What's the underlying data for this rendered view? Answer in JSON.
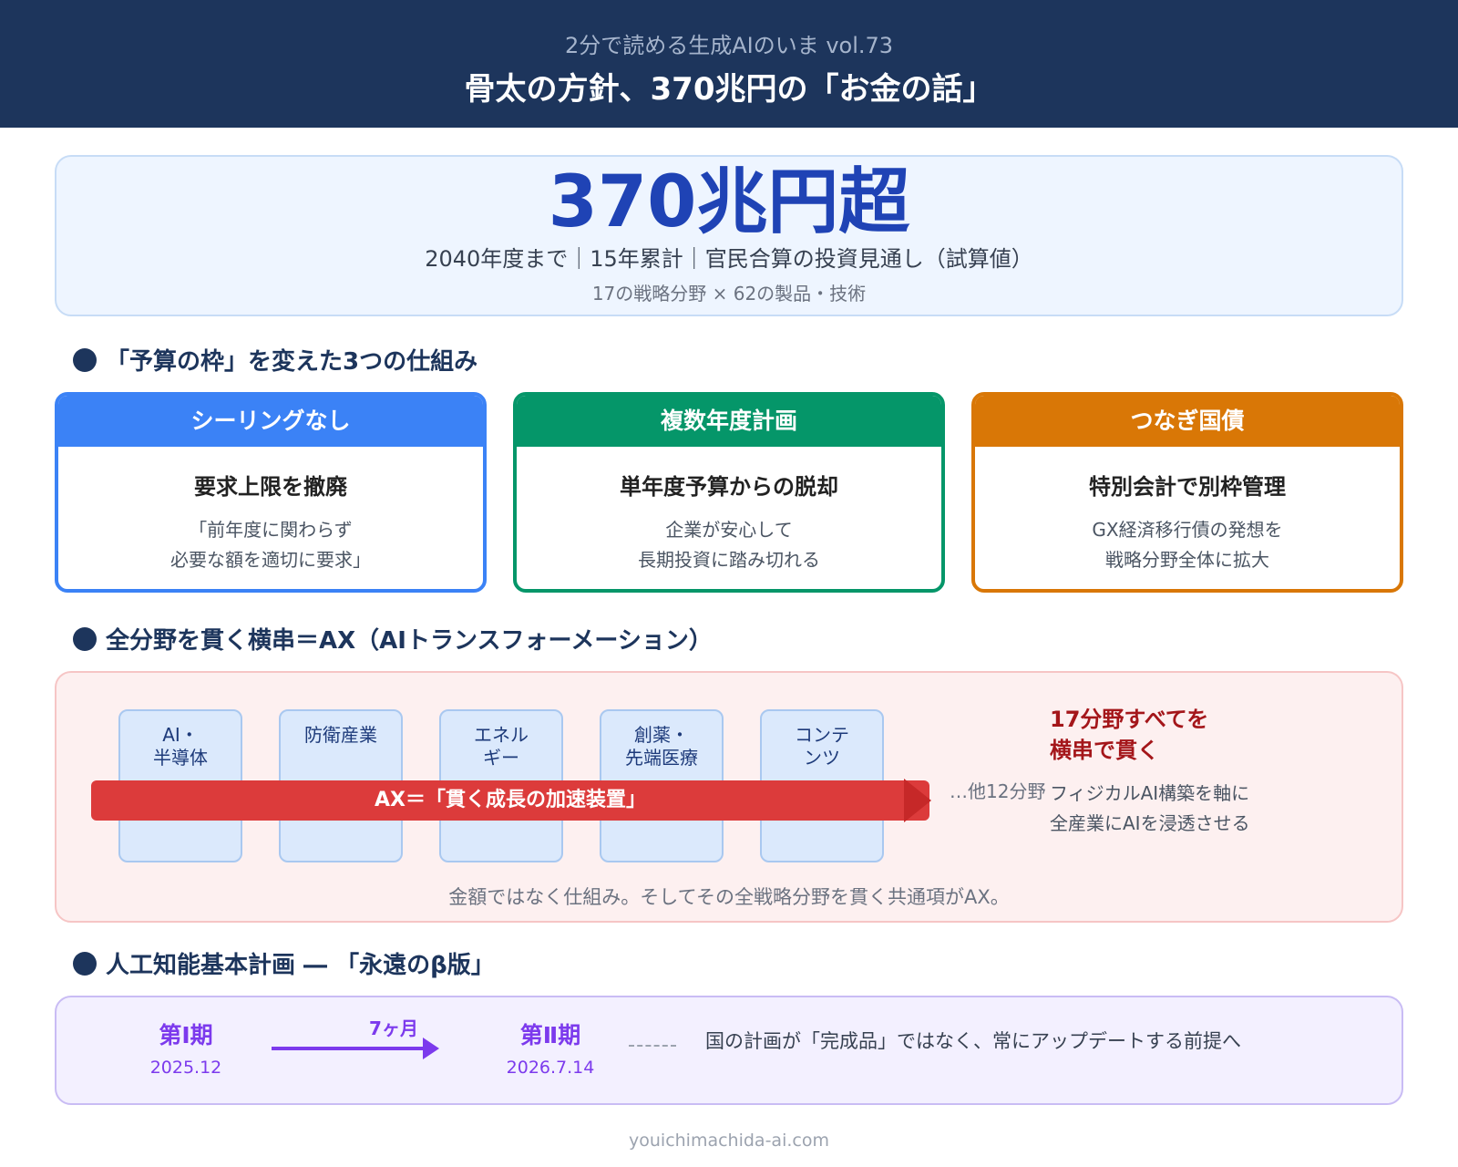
{
  "header": {
    "subtitle": "2分で読める生成AIのいま vol.73",
    "title": "骨太の方針、370兆円の「お金の話」"
  },
  "hero": {
    "amount": "370兆円超",
    "line1": "2040年度まで｜15年累計｜官民合算の投資見通し（試算値）",
    "line2": "17の戦略分野 × 62の製品・技術"
  },
  "section1": {
    "title": "「予算の枠」を変えた3つの仕組み",
    "cards": [
      {
        "header": "シーリングなし",
        "main": "要求上限を撤廃",
        "desc": "「前年度に関わらず\n必要な額を適切に要求」",
        "color": "#3b82f6"
      },
      {
        "header": "複数年度計画",
        "main": "単年度予算からの脱却",
        "desc": "企業が安心して\n長期投資に踏み切れる",
        "color": "#059669"
      },
      {
        "header": "つなぎ国債",
        "main": "特別会計で別枠管理",
        "desc": "GX経済移行債の発想を\n戦略分野全体に拡大",
        "color": "#d97706"
      }
    ]
  },
  "section2": {
    "title": "全分野を貫く横串＝AX（AIトランスフォーメーション）",
    "pillars": [
      "AI・\n半導体",
      "防衛産業",
      "エネル\nギー",
      "創薬・\n先端医療",
      "コンテ\nンツ"
    ],
    "arrow_label": "AX＝「貫く成長の加速装置」",
    "others": "…他12分野",
    "highlight": "17分野すべてを\n横串で貫く",
    "desc": "フィジカルAI構築を軸に\n全産業にAIを浸透させる",
    "note": "金額ではなく仕組み。そしてその全戦略分野を貫く共通項がAX。"
  },
  "section3": {
    "title": "人工知能基本計画 ― 「永遠のβ版」",
    "phase1": {
      "label": "第Ⅰ期",
      "date": "2025.12"
    },
    "interval": "7ヶ月",
    "phase2": {
      "label": "第Ⅱ期",
      "date": "2026.7.14"
    },
    "note": "国の計画が「完成品」ではなく、常にアップデートする前提へ"
  },
  "footer": "youichimachida-ai.com"
}
